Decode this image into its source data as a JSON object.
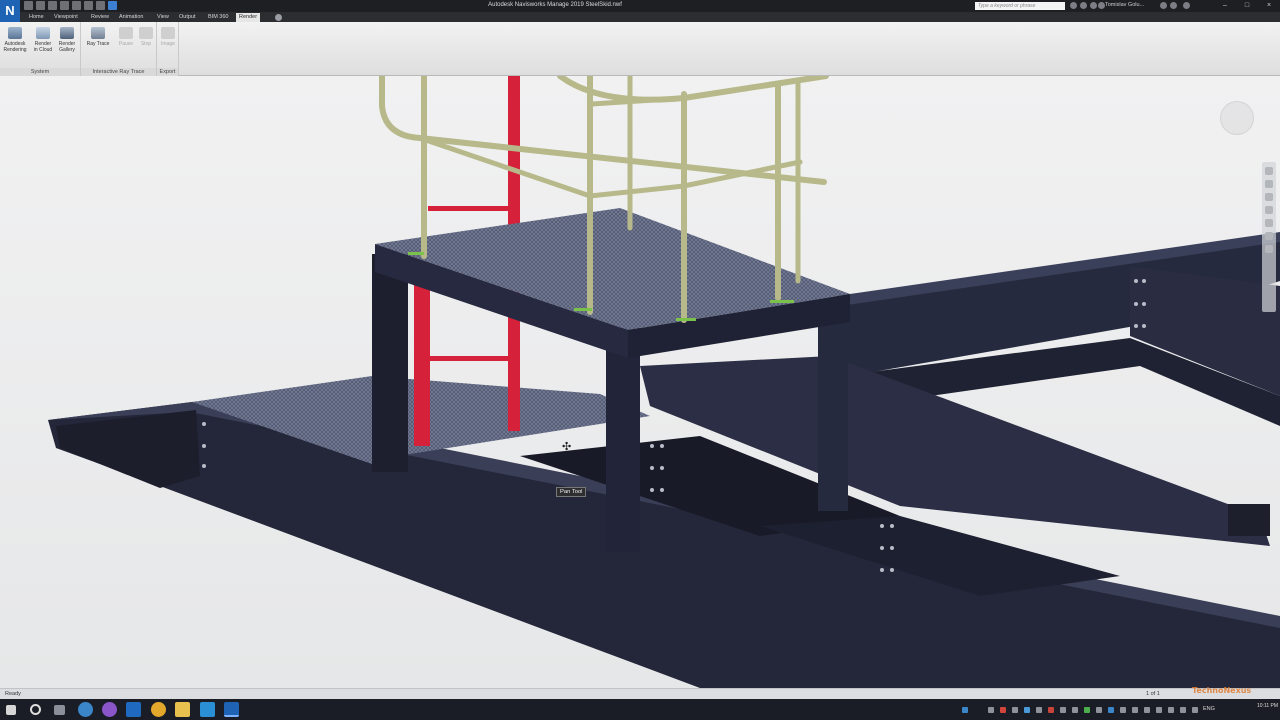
{
  "window": {
    "title": "Autodesk Navisworks Manage 2019    SteelSkid.nwf",
    "logo_letter": "N",
    "search_placeholder": "Type a keyword or phrase",
    "user_name": "Tomislav Golu...",
    "controls": [
      "–",
      "□",
      "×"
    ]
  },
  "ribbon": {
    "tabs": [
      "Home",
      "Viewpoint",
      "Review",
      "Animation",
      "View",
      "Output",
      "BIM 360",
      "Render"
    ],
    "active_tab": "Render",
    "groups": [
      {
        "label": "System",
        "buttons": [
          {
            "label": "Autodesk Rendering",
            "line1": "Autodesk",
            "line2": "Rendering"
          },
          {
            "label": "Render in Cloud",
            "line1": "Render",
            "line2": "in Cloud"
          },
          {
            "label": "Render Gallery",
            "line1": "Render",
            "line2": "Gallery"
          }
        ]
      },
      {
        "label": "Interactive Ray Trace",
        "buttons": [
          {
            "label": "Ray Trace",
            "line1": "Ray Trace",
            "line2": ""
          },
          {
            "label": "Pause",
            "line1": "Pause",
            "line2": ""
          },
          {
            "label": "Stop",
            "line1": "Stop",
            "line2": ""
          }
        ]
      },
      {
        "label": "Export",
        "buttons": [
          {
            "label": "Image",
            "line1": "Image",
            "line2": ""
          }
        ]
      }
    ]
  },
  "viewport": {
    "tooltip": "Pan Tool",
    "cursor": "move-cursor",
    "colors": {
      "steel": "#2c2f45",
      "grating": "#5b6278",
      "handrail": "#b8b98a",
      "ladder": "#d8243a",
      "background": "#ececed"
    }
  },
  "statusbar": {
    "status": "Ready",
    "page": "1 of 1"
  },
  "taskbar": {
    "lang": "ENG",
    "time": "10:11 PM",
    "watermark": "TechnoNexus",
    "apps": [
      "start-icon",
      "cortana-icon",
      "task-view-icon",
      "edge-icon",
      "firefox-icon",
      "outlook-icon",
      "chrome-icon",
      "file-explorer-icon",
      "store-icon",
      "navisworks-icon"
    ]
  }
}
